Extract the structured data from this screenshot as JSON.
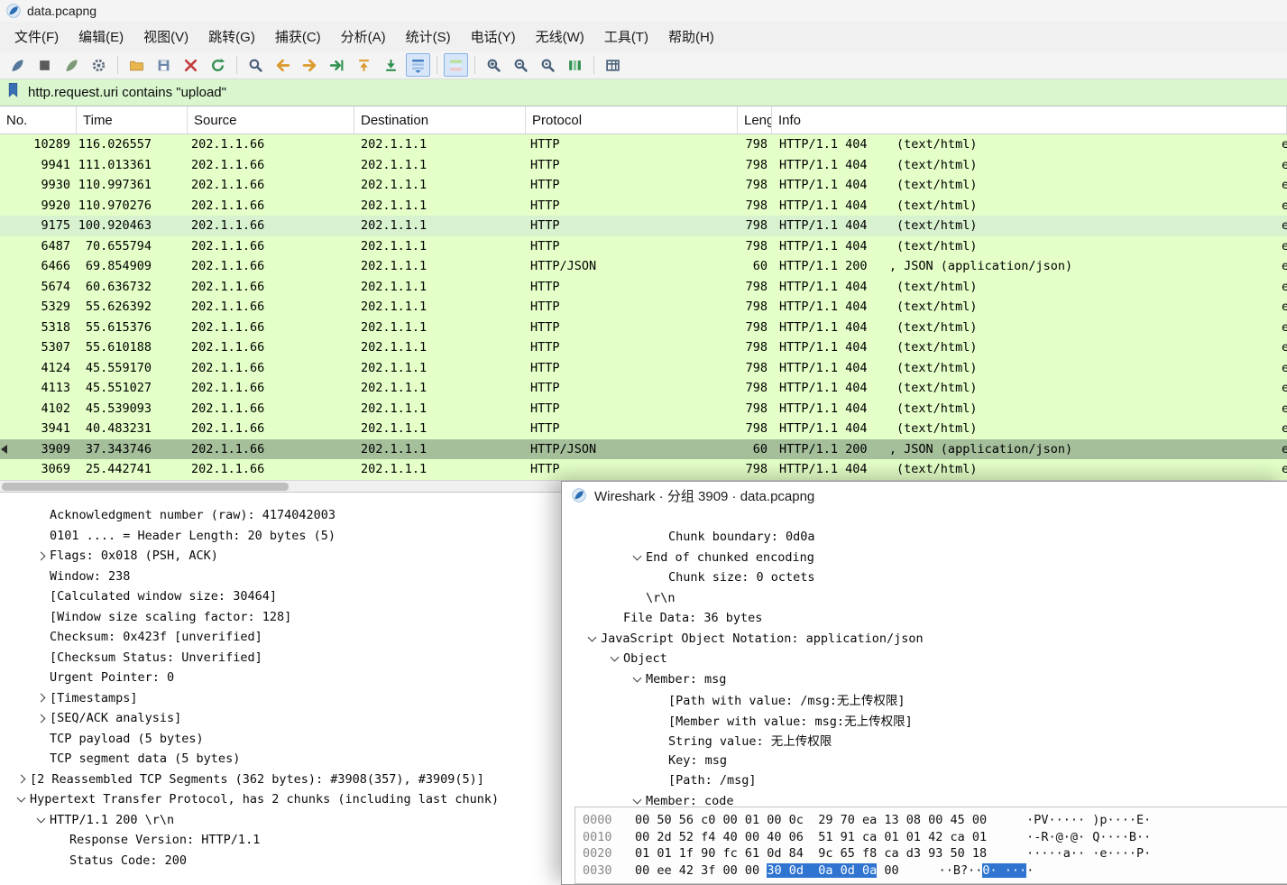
{
  "window": {
    "title": "data.pcapng"
  },
  "menu_bar": {
    "items": [
      "文件(F)",
      "编辑(E)",
      "视图(V)",
      "跳转(G)",
      "捕获(C)",
      "分析(A)",
      "统计(S)",
      "电话(Y)",
      "无线(W)",
      "工具(T)",
      "帮助(H)"
    ]
  },
  "toolbar": {
    "buttons": [
      {
        "name": "capture-start-icon",
        "pressed": false
      },
      {
        "name": "capture-stop-icon",
        "pressed": false
      },
      {
        "name": "capture-restart-icon",
        "pressed": false
      },
      {
        "name": "capture-options-icon",
        "pressed": false
      },
      {
        "name": "separator"
      },
      {
        "name": "open-file-icon",
        "pressed": false
      },
      {
        "name": "save-file-icon",
        "pressed": false
      },
      {
        "name": "close-file-icon",
        "pressed": false
      },
      {
        "name": "reload-icon",
        "pressed": false
      },
      {
        "name": "separator"
      },
      {
        "name": "find-packet-icon",
        "pressed": false
      },
      {
        "name": "go-back-icon",
        "pressed": false
      },
      {
        "name": "go-forward-icon",
        "pressed": false
      },
      {
        "name": "go-to-packet-icon",
        "pressed": false
      },
      {
        "name": "go-top-icon",
        "pressed": false
      },
      {
        "name": "go-bottom-icon",
        "pressed": false
      },
      {
        "name": "auto-scroll-icon",
        "pressed": true
      },
      {
        "name": "separator"
      },
      {
        "name": "colorize-icon",
        "pressed": true
      },
      {
        "name": "separator"
      },
      {
        "name": "zoom-in-icon",
        "pressed": false
      },
      {
        "name": "zoom-out-icon",
        "pressed": false
      },
      {
        "name": "zoom-reset-icon",
        "pressed": false
      },
      {
        "name": "resize-columns-icon",
        "pressed": false
      },
      {
        "name": "separator"
      },
      {
        "name": "columns-pref-icon",
        "pressed": false
      }
    ]
  },
  "filter_bar": {
    "value": "http.request.uri contains \"upload\""
  },
  "packet_list": {
    "columns": [
      "No.",
      "Time",
      "Source",
      "Destination",
      "Protocol",
      "Lengt",
      "Info"
    ],
    "rows": [
      {
        "no": "10289",
        "time": "116.026557",
        "source": "202.1.1.66",
        "destination": "202.1.1.1",
        "protocol": "HTTP",
        "length": "798",
        "info": "HTTP/1.1 404    (text/html)",
        "edge": "e",
        "state": "normal"
      },
      {
        "no": "9941",
        "time": "111.013361",
        "source": "202.1.1.66",
        "destination": "202.1.1.1",
        "protocol": "HTTP",
        "length": "798",
        "info": "HTTP/1.1 404    (text/html)",
        "edge": "e",
        "state": "normal"
      },
      {
        "no": "9930",
        "time": "110.997361",
        "source": "202.1.1.66",
        "destination": "202.1.1.1",
        "protocol": "HTTP",
        "length": "798",
        "info": "HTTP/1.1 404    (text/html)",
        "edge": "e",
        "state": "normal"
      },
      {
        "no": "9920",
        "time": "110.970276",
        "source": "202.1.1.66",
        "destination": "202.1.1.1",
        "protocol": "HTTP",
        "length": "798",
        "info": "HTTP/1.1 404    (text/html)",
        "edge": "e",
        "state": "normal"
      },
      {
        "no": "9175",
        "time": "100.920463",
        "source": "202.1.1.66",
        "destination": "202.1.1.1",
        "protocol": "HTTP",
        "length": "798",
        "info": "HTTP/1.1 404    (text/html)",
        "edge": "e",
        "state": "related"
      },
      {
        "no": "6487",
        "time": "70.655794",
        "source": "202.1.1.66",
        "destination": "202.1.1.1",
        "protocol": "HTTP",
        "length": "798",
        "info": "HTTP/1.1 404    (text/html)",
        "edge": "e",
        "state": "normal"
      },
      {
        "no": "6466",
        "time": "69.854909",
        "source": "202.1.1.66",
        "destination": "202.1.1.1",
        "protocol": "HTTP/JSON",
        "length": "60",
        "info": "HTTP/1.1 200   , JSON (application/json)",
        "edge": "e",
        "state": "normal"
      },
      {
        "no": "5674",
        "time": "60.636732",
        "source": "202.1.1.66",
        "destination": "202.1.1.1",
        "protocol": "HTTP",
        "length": "798",
        "info": "HTTP/1.1 404    (text/html)",
        "edge": "e",
        "state": "normal"
      },
      {
        "no": "5329",
        "time": "55.626392",
        "source": "202.1.1.66",
        "destination": "202.1.1.1",
        "protocol": "HTTP",
        "length": "798",
        "info": "HTTP/1.1 404    (text/html)",
        "edge": "e",
        "state": "normal"
      },
      {
        "no": "5318",
        "time": "55.615376",
        "source": "202.1.1.66",
        "destination": "202.1.1.1",
        "protocol": "HTTP",
        "length": "798",
        "info": "HTTP/1.1 404    (text/html)",
        "edge": "e",
        "state": "normal"
      },
      {
        "no": "5307",
        "time": "55.610188",
        "source": "202.1.1.66",
        "destination": "202.1.1.1",
        "protocol": "HTTP",
        "length": "798",
        "info": "HTTP/1.1 404    (text/html)",
        "edge": "e",
        "state": "normal"
      },
      {
        "no": "4124",
        "time": "45.559170",
        "source": "202.1.1.66",
        "destination": "202.1.1.1",
        "protocol": "HTTP",
        "length": "798",
        "info": "HTTP/1.1 404    (text/html)",
        "edge": "e",
        "state": "normal"
      },
      {
        "no": "4113",
        "time": "45.551027",
        "source": "202.1.1.66",
        "destination": "202.1.1.1",
        "protocol": "HTTP",
        "length": "798",
        "info": "HTTP/1.1 404    (text/html)",
        "edge": "e",
        "state": "normal"
      },
      {
        "no": "4102",
        "time": "45.539093",
        "source": "202.1.1.66",
        "destination": "202.1.1.1",
        "protocol": "HTTP",
        "length": "798",
        "info": "HTTP/1.1 404    (text/html)",
        "edge": "e",
        "state": "normal"
      },
      {
        "no": "3941",
        "time": "40.483231",
        "source": "202.1.1.66",
        "destination": "202.1.1.1",
        "protocol": "HTTP",
        "length": "798",
        "info": "HTTP/1.1 404    (text/html)",
        "edge": "e",
        "state": "normal"
      },
      {
        "no": "3909",
        "time": "37.343746",
        "source": "202.1.1.66",
        "destination": "202.1.1.1",
        "protocol": "HTTP/JSON",
        "length": "60",
        "info": "HTTP/1.1 200   , JSON (application/json)",
        "edge": "e",
        "state": "selected"
      },
      {
        "no": "3069",
        "time": "25.442741",
        "source": "202.1.1.66",
        "destination": "202.1.1.1",
        "protocol": "HTTP",
        "length": "798",
        "info": "HTTP/1.1 404    (text/html)",
        "edge": "e",
        "state": "normal"
      }
    ]
  },
  "detail_pane": {
    "lines": [
      {
        "indent": 1,
        "expander": "none",
        "text": "Acknowledgment number (raw): 4174042003"
      },
      {
        "indent": 1,
        "expander": "none",
        "text": "0101 .... = Header Length: 20 bytes (5)"
      },
      {
        "indent": 1,
        "expander": ">",
        "text": "Flags: 0x018 (PSH, ACK)"
      },
      {
        "indent": 1,
        "expander": "none",
        "text": "Window: 238"
      },
      {
        "indent": 1,
        "expander": "none",
        "text": "[Calculated window size: 30464]"
      },
      {
        "indent": 1,
        "expander": "none",
        "text": "[Window size scaling factor: 128]"
      },
      {
        "indent": 1,
        "expander": "none",
        "text": "Checksum: 0x423f [unverified]"
      },
      {
        "indent": 1,
        "expander": "none",
        "text": "[Checksum Status: Unverified]"
      },
      {
        "indent": 1,
        "expander": "none",
        "text": "Urgent Pointer: 0"
      },
      {
        "indent": 1,
        "expander": ">",
        "text": "[Timestamps]"
      },
      {
        "indent": 1,
        "expander": ">",
        "text": "[SEQ/ACK analysis]"
      },
      {
        "indent": 1,
        "expander": "none",
        "text": "TCP payload (5 bytes)"
      },
      {
        "indent": 1,
        "expander": "none",
        "text": "TCP segment data (5 bytes)"
      },
      {
        "indent": 0,
        "expander": ">",
        "text": "[2 Reassembled TCP Segments (362 bytes): #3908(357), #3909(5)]"
      },
      {
        "indent": 0,
        "expander": "v",
        "text": "Hypertext Transfer Protocol, has 2 chunks (including last chunk)"
      },
      {
        "indent": 1,
        "expander": "v",
        "text": "HTTP/1.1 200 \\r\\n"
      },
      {
        "indent": 2,
        "expander": "none",
        "text": "Response Version: HTTP/1.1"
      },
      {
        "indent": 2,
        "expander": "none",
        "text": "Status Code: 200"
      }
    ]
  },
  "popup": {
    "title": "Wireshark · 分组 3909 · data.pcapng",
    "tree": [
      {
        "indent": 3,
        "expander": "none",
        "text": "Chunk boundary: 0d0a"
      },
      {
        "indent": 2,
        "expander": "v",
        "text": "End of chunked encoding"
      },
      {
        "indent": 3,
        "expander": "none",
        "text": "Chunk size: 0 octets"
      },
      {
        "indent": 2,
        "expander": "none",
        "text": "\\r\\n"
      },
      {
        "indent": 1,
        "expander": "none",
        "text": "File Data: 36 bytes"
      },
      {
        "indent": 0,
        "expander": "v",
        "text": "JavaScript Object Notation: application/json"
      },
      {
        "indent": 1,
        "expander": "v",
        "text": "Object"
      },
      {
        "indent": 2,
        "expander": "v",
        "text": "Member: msg"
      },
      {
        "indent": 3,
        "expander": "none",
        "text": "[Path with value: /msg:无上传权限]"
      },
      {
        "indent": 3,
        "expander": "none",
        "text": "[Member with value: msg:无上传权限]"
      },
      {
        "indent": 3,
        "expander": "none",
        "text": "String value: 无上传权限"
      },
      {
        "indent": 3,
        "expander": "none",
        "text": "Key: msg"
      },
      {
        "indent": 3,
        "expander": "none",
        "text": "[Path: /msg]"
      },
      {
        "indent": 2,
        "expander": "v",
        "text": "Member: code"
      }
    ],
    "hex_view": {
      "rows": [
        {
          "offset": "0000",
          "hex": [
            {
              "t": "00 50 56 c0 00 01 00 0c  29 70 ea 13 08 00 45 00",
              "h": false
            }
          ],
          "ascii": [
            {
              "t": "·PV····· )p····E·",
              "h": false
            }
          ]
        },
        {
          "offset": "0010",
          "hex": [
            {
              "t": "00 2d 52 f4 40 00 40 06  51 91 ca 01 01 42 ca 01",
              "h": false
            }
          ],
          "ascii": [
            {
              "t": "·-R·@·@· Q····B··",
              "h": false
            }
          ]
        },
        {
          "offset": "0020",
          "hex": [
            {
              "t": "01 01 1f 90 fc 61 0d 84  9c 65 f8 ca d3 93 50 18",
              "h": false
            }
          ],
          "ascii": [
            {
              "t": "·····a·· ·e····P·",
              "h": false
            }
          ]
        },
        {
          "offset": "0030",
          "hex": [
            {
              "t": "00 ee 42 3f 00 00 ",
              "h": false
            },
            {
              "t": "30 0d  0a 0d 0a",
              "h": true
            },
            {
              "t": " 00",
              "h": false
            }
          ],
          "ascii": [
            {
              "t": "··B?··",
              "h": false
            },
            {
              "t": "0· ···",
              "h": true
            },
            {
              "t": "·",
              "h": false
            }
          ]
        }
      ]
    }
  },
  "colors": {
    "http_row": "#e4ffc7",
    "selected_row": "#a5bf9b",
    "related_row": "#d8f2d0",
    "filter_valid_green": "#d9f6cf",
    "hex_highlight_blue": "#2f74d0"
  }
}
